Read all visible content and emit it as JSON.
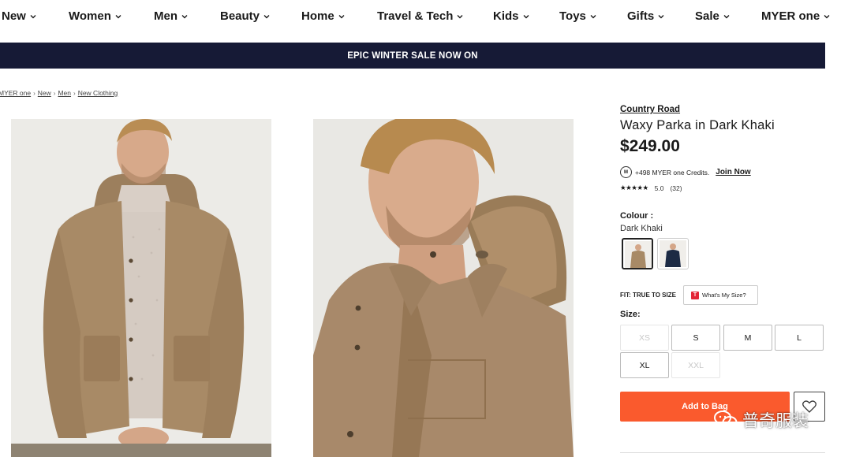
{
  "nav": {
    "items": [
      {
        "label": "New"
      },
      {
        "label": "Women"
      },
      {
        "label": "Men"
      },
      {
        "label": "Beauty"
      },
      {
        "label": "Home"
      },
      {
        "label": "Travel & Tech"
      },
      {
        "label": "Kids"
      },
      {
        "label": "Toys"
      },
      {
        "label": "Gifts"
      },
      {
        "label": "Sale"
      },
      {
        "label": "MYER one"
      }
    ]
  },
  "banner": {
    "text": "EPIC WINTER SALE NOW ON"
  },
  "breadcrumb": [
    "MYER one",
    "New",
    "Men",
    "New Clothing"
  ],
  "product": {
    "brand": "Country Road",
    "title": "Waxy Parka in Dark Khaki",
    "price": "$249.00",
    "credits_text": "+498 MYER one Credits.",
    "join_now": "Join Now",
    "stars": "★★★★★",
    "rating": "5.0",
    "reviews": "(32)",
    "colour_label": "Colour :",
    "colour_value": "Dark Khaki",
    "fit_label": "FIT: TRUE TO SIZE",
    "fit_button": "What's My Size?",
    "size_label": "Size:",
    "sizes": [
      {
        "label": "XS",
        "available": false
      },
      {
        "label": "S",
        "available": true
      },
      {
        "label": "M",
        "available": true
      },
      {
        "label": "L",
        "available": true
      },
      {
        "label": "XL",
        "available": true
      },
      {
        "label": "XXL",
        "available": false
      }
    ],
    "add_to_bag": "Add to Bag"
  },
  "watermark": "普奇服装",
  "colors": {
    "banner_bg": "#161a36",
    "accent": "#fa5a2d",
    "khaki": "#a88a66",
    "navy": "#1c2a44"
  }
}
